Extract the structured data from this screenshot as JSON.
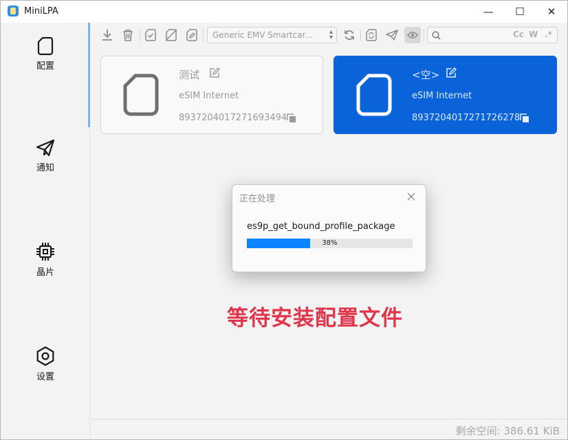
{
  "window": {
    "title": "MiniLPA",
    "minimize_glyph": "—",
    "maximize_glyph": "☐",
    "close_glyph": "✕"
  },
  "sidebar": {
    "items": [
      {
        "label": "配置",
        "icon": "sim-card-icon",
        "active": true
      },
      {
        "label": "通知",
        "icon": "send-icon",
        "active": false
      },
      {
        "label": "晶片",
        "icon": "chip-icon",
        "active": false
      },
      {
        "label": "设置",
        "icon": "settings-icon",
        "active": false
      }
    ]
  },
  "toolbar": {
    "reader_select": {
      "value": "Generic EMV Smartcar..."
    },
    "search": {
      "placeholder": "",
      "value": ""
    },
    "search_options": {
      "case": "Cc",
      "word": "W",
      "regex": ".*"
    },
    "icons": [
      "download-icon",
      "delete-icon",
      "enable-icon",
      "disable-icon",
      "rename-icon",
      "refresh-icon",
      "sim-refresh-icon",
      "send-icon",
      "eye-icon",
      "search-icon"
    ]
  },
  "profiles": [
    {
      "name": "测试",
      "provider": "eSIM Internet",
      "iccid": "8937204017271693494",
      "active": false
    },
    {
      "name": "<空>",
      "provider": "eSIM Internet",
      "iccid": "8937204017271726278",
      "active": true
    }
  ],
  "dialog": {
    "title": "正在处理",
    "message": "es9p_get_bound_profile_package",
    "progress_percent": 38,
    "progress_text": "38%"
  },
  "annotation": {
    "text": "等待安装配置文件",
    "color": "#e0354a"
  },
  "status": {
    "free_space": "剩余空间: 386.61 KiB"
  },
  "colors": {
    "accent": "#0a63d8",
    "progress": "#0a84ff"
  }
}
